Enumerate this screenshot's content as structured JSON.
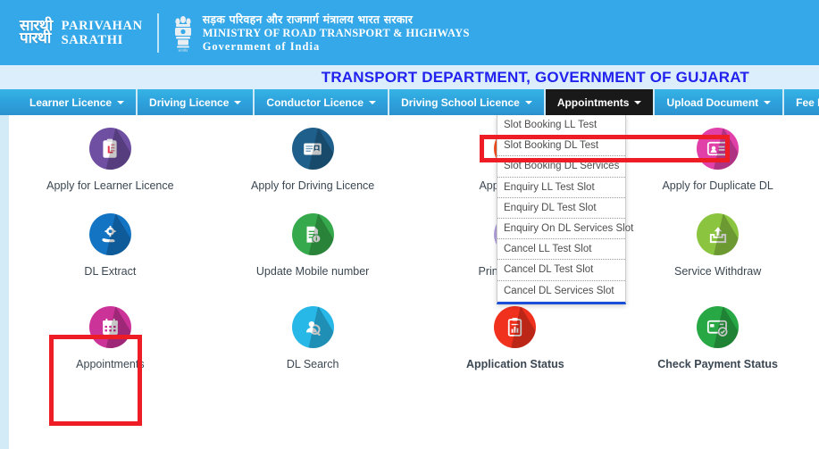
{
  "header": {
    "logo": {
      "devanagari_line1": "सारथी",
      "devanagari_line2": "पारथी",
      "en_line1": "PARIVAHAN",
      "en_line2": "SARATHI",
      "emblem_name": "india-national-emblem"
    },
    "ministry": {
      "hindi": "सड़क परिवहन और राजमार्ग मंत्रालय भारत सरकार",
      "english_line1": "MINISTRY OF ROAD TRANSPORT & HIGHWAYS",
      "english_line2": "Government of India"
    },
    "banner_color": "#34a8e8"
  },
  "title_strip": {
    "department_title": "TRANSPORT DEPARTMENT, GOVERNMENT OF GUJARAT",
    "text_color": "#2222ee",
    "background": "#dceefb"
  },
  "navbar": {
    "active_index": 4,
    "active_background": "#191919",
    "items": [
      {
        "label": "Learner Licence",
        "has_caret": true
      },
      {
        "label": "Driving Licence",
        "has_caret": true
      },
      {
        "label": "Conductor Licence",
        "has_caret": true
      },
      {
        "label": "Driving School Licence",
        "has_caret": true
      },
      {
        "label": "Appointments",
        "has_caret": true
      },
      {
        "label": "Upload Document",
        "has_caret": true
      },
      {
        "label": "Fee Payments",
        "has_caret": true
      }
    ]
  },
  "dropdown": {
    "owner": "Appointments",
    "accent_color": "#1b4fd8",
    "items": [
      {
        "label": "Slot Booking LL Test"
      },
      {
        "label": "Slot Booking DL Test"
      },
      {
        "label": "Slot Booking DL Services"
      },
      {
        "label": "Enquiry LL Test Slot"
      },
      {
        "label": "Enquiry DL Test Slot"
      },
      {
        "label": "Enquiry On DL Services Slot"
      },
      {
        "label": "Cancel LL Test Slot"
      },
      {
        "label": "Cancel DL Test Slot"
      },
      {
        "label": "Cancel DL Services Slot"
      }
    ]
  },
  "highlights": {
    "color": "#ee1c25",
    "menu_item_target": "Slot Booking DL Test",
    "tile_target": "Appointments"
  },
  "tiles": {
    "row1": [
      {
        "label": "Apply for Learner Licence",
        "icon": "clipboard-l-icon",
        "color": "#6f4fa2"
      },
      {
        "label": "Apply for Driving Licence",
        "icon": "id-card-icon",
        "color": "#1f5f8b"
      },
      {
        "label": "Apply for DL R",
        "icon": "document-renewal-icon",
        "color": "#f4511e"
      },
      {
        "label": "Apply for Duplicate DL",
        "icon": "duplicate-dl-icon",
        "color": "#e040a8"
      }
    ],
    "row2": [
      {
        "label": "DL Extract",
        "icon": "hand-gear-icon",
        "color": "#1474c4"
      },
      {
        "label": "Update Mobile number",
        "icon": "document-info-icon",
        "color": "#35a94b"
      },
      {
        "label": "Print Applicatio",
        "icon": "printer-icon",
        "color": "#b0a0dd"
      },
      {
        "label": "Service Withdraw",
        "icon": "upload-box-icon",
        "color": "#8bc53f"
      }
    ],
    "row3": [
      {
        "label": "Appointments",
        "icon": "calendar-icon",
        "color": "#cc3399"
      },
      {
        "label": "DL Search",
        "icon": "person-search-icon",
        "color": "#28b8e8"
      },
      {
        "label": "Application Status",
        "icon": "clipboard-chart-icon",
        "color": "#f0311e"
      },
      {
        "label": "Check Payment Status",
        "icon": "payment-card-check-icon",
        "color": "#28a745"
      }
    ]
  }
}
